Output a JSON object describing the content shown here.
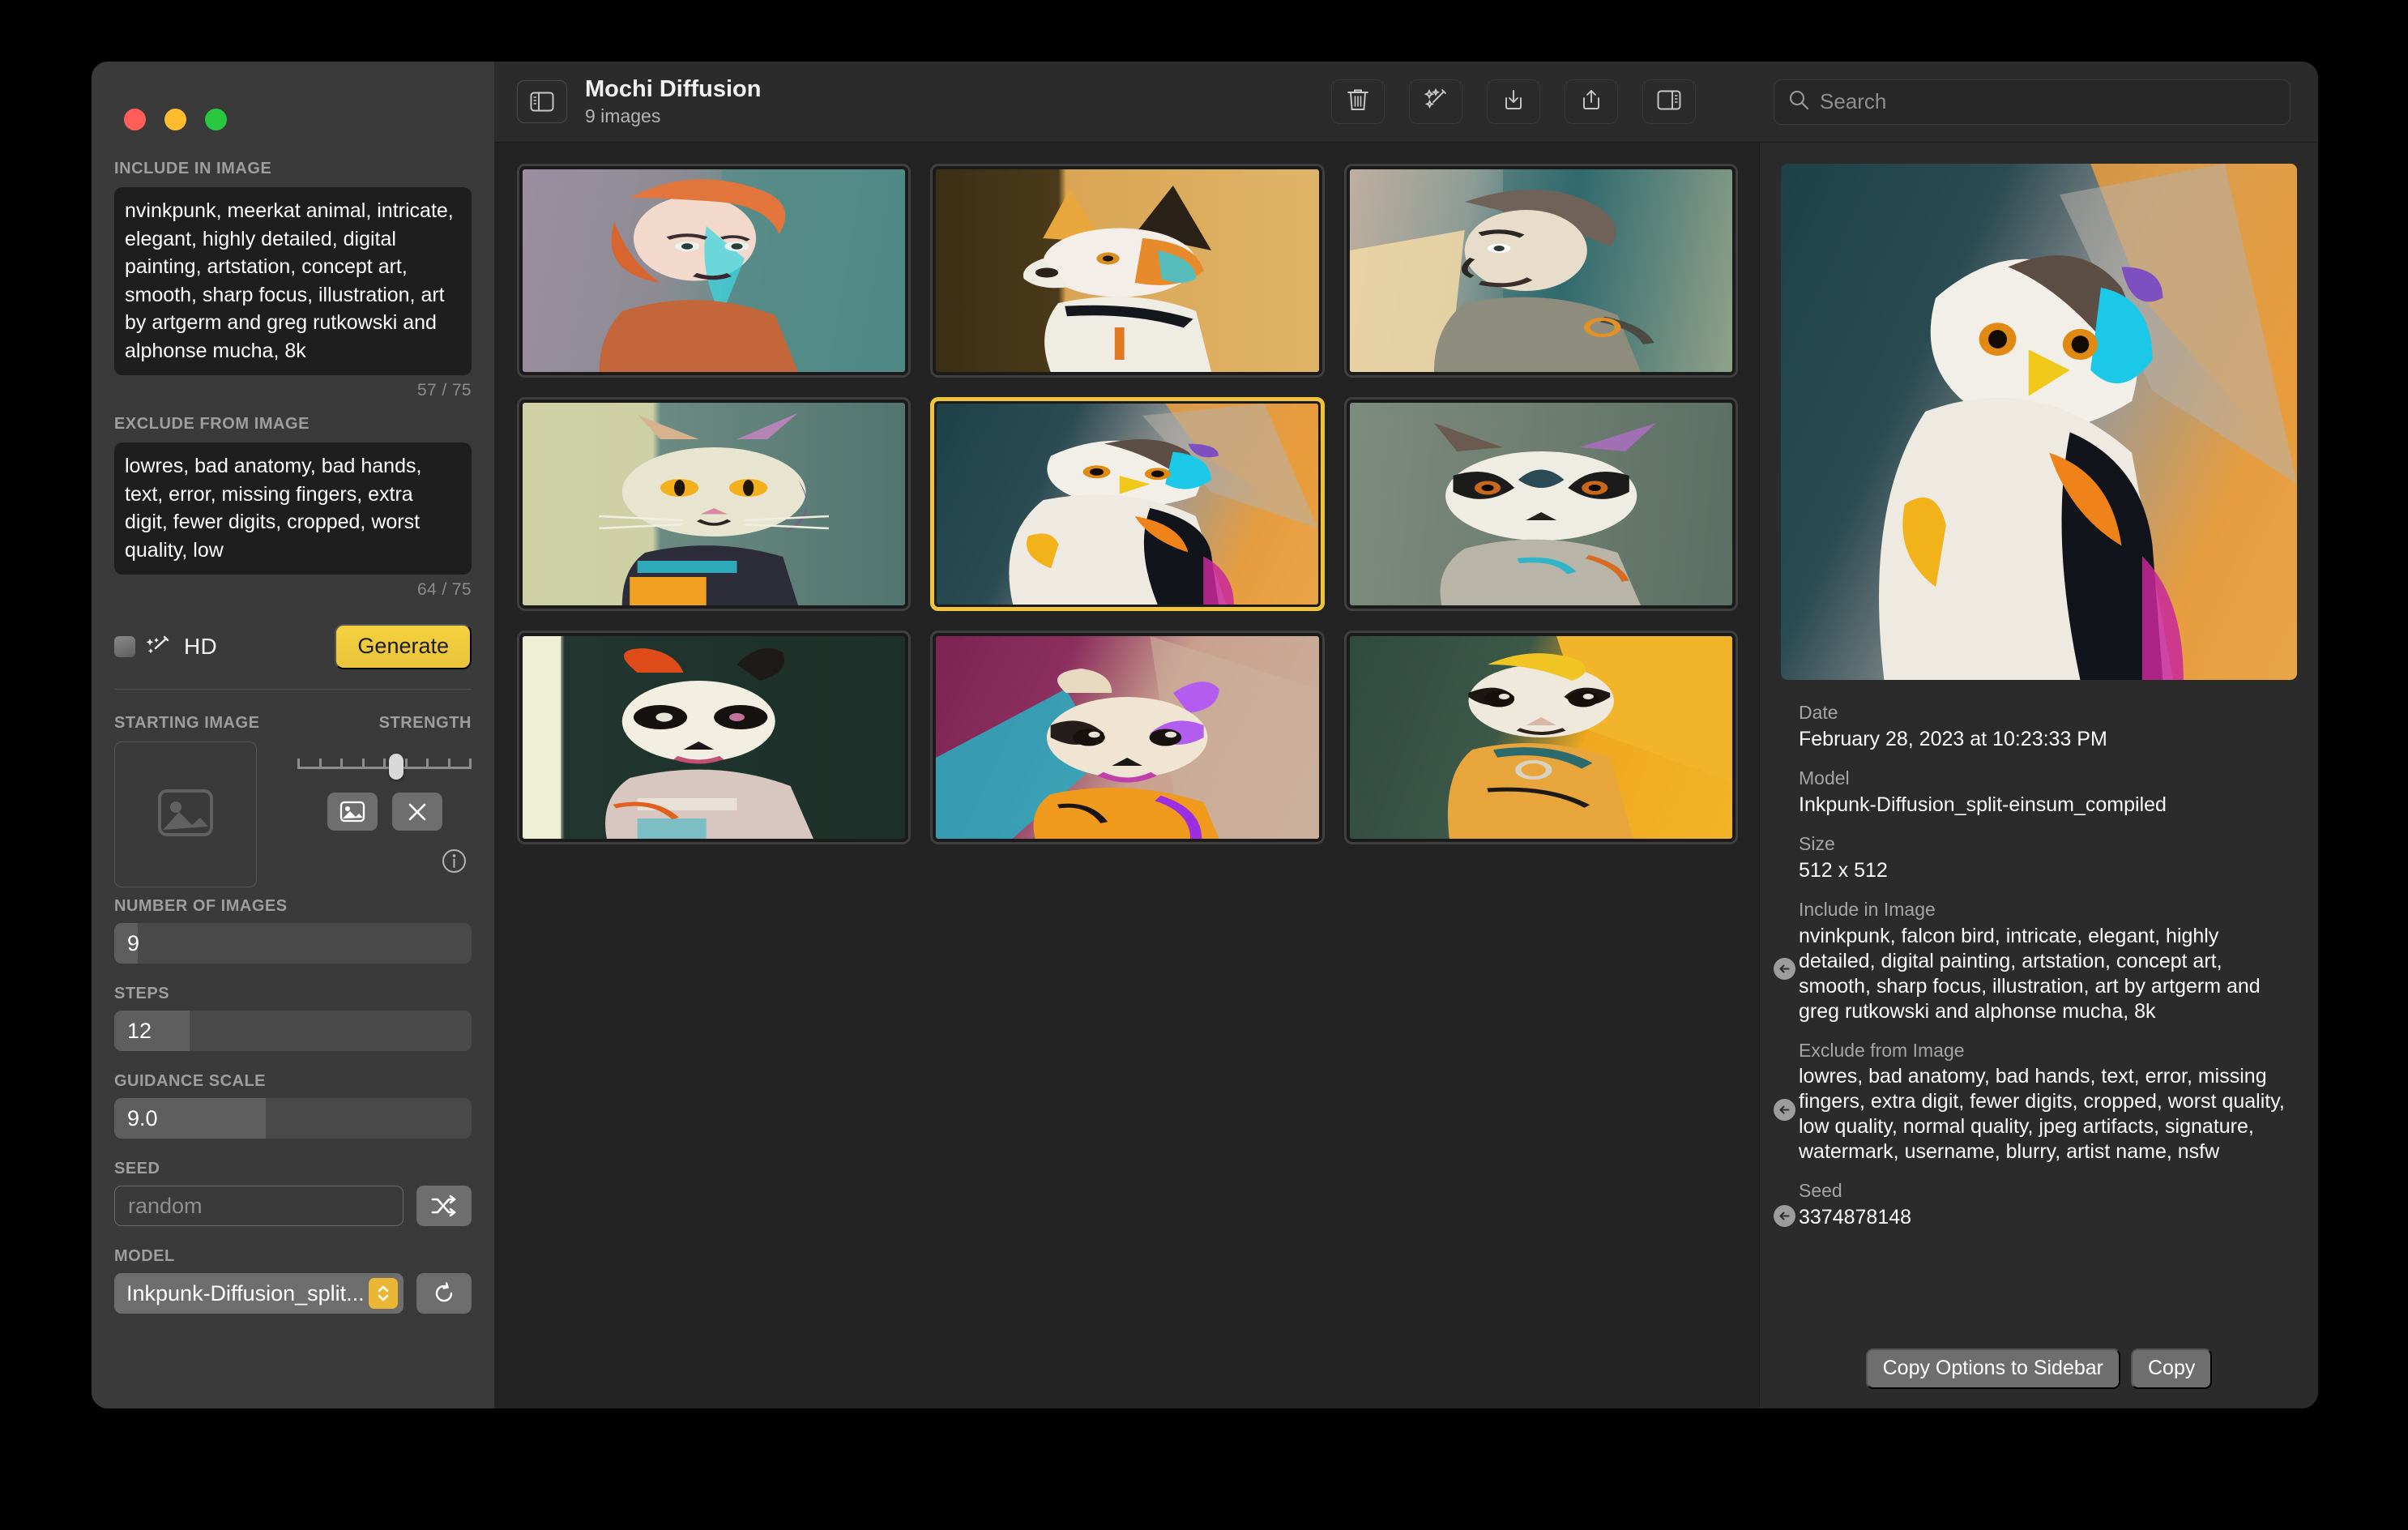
{
  "window": {
    "traffic_lights": [
      "close",
      "minimize",
      "zoom"
    ]
  },
  "sidebar": {
    "include": {
      "label": "INCLUDE IN IMAGE",
      "value": "nvinkpunk, meerkat animal, intricate, elegant, highly detailed, digital painting, artstation, concept art, smooth, sharp focus, illustration, art by artgerm and greg rutkowski and alphonse mucha, 8k",
      "counter": "57 / 75"
    },
    "exclude": {
      "label": "EXCLUDE FROM IMAGE",
      "value": "lowres, bad anatomy, bad hands, text, error, missing fingers, extra digit, fewer digits, cropped, worst quality, low",
      "counter": "64 / 75"
    },
    "hd": {
      "label": "HD",
      "checked": false
    },
    "generate_label": "Generate",
    "starting_image": {
      "label": "STARTING IMAGE",
      "empty": true
    },
    "strength": {
      "label": "STRENGTH",
      "value": 0.525
    },
    "number_of_images": {
      "label": "NUMBER OF IMAGES",
      "value": "9",
      "fill": 0.065
    },
    "steps": {
      "label": "STEPS",
      "value": "12",
      "fill": 0.21
    },
    "guidance_scale": {
      "label": "GUIDANCE SCALE",
      "value": "9.0",
      "fill": 0.425
    },
    "seed": {
      "label": "SEED",
      "value": "",
      "placeholder": "random"
    },
    "model": {
      "label": "MODEL",
      "value": "Inkpunk-Diffusion_split..."
    }
  },
  "toolbar": {
    "title": "Mochi Diffusion",
    "subtitle": "9 images",
    "buttons": [
      "trash",
      "wand",
      "download",
      "share",
      "inspector"
    ],
    "search": {
      "placeholder": "Search",
      "value": ""
    }
  },
  "gallery": {
    "items": [
      {
        "name": "woman-portrait",
        "selected": false,
        "art": "a-woman"
      },
      {
        "name": "dog-portrait",
        "selected": false,
        "art": "a-dog"
      },
      {
        "name": "man-portrait",
        "selected": false,
        "art": "a-man"
      },
      {
        "name": "cat-portrait",
        "selected": false,
        "art": "a-cat"
      },
      {
        "name": "falcon-portrait",
        "selected": true,
        "art": "a-bird"
      },
      {
        "name": "raccoon-portrait",
        "selected": false,
        "art": "a-raccoon"
      },
      {
        "name": "panda-portrait",
        "selected": false,
        "art": "a-panda"
      },
      {
        "name": "ferret-portrait",
        "selected": false,
        "art": "a-ferret"
      },
      {
        "name": "meerkat-portrait",
        "selected": false,
        "art": "a-meerkat"
      }
    ]
  },
  "inspector": {
    "preview_art": "a-bird",
    "date": {
      "key": "Date",
      "value": "February 28, 2023 at 10:23:33 PM"
    },
    "model": {
      "key": "Model",
      "value": "Inkpunk-Diffusion_split-einsum_compiled"
    },
    "size": {
      "key": "Size",
      "value": "512 x 512"
    },
    "include": {
      "key": "Include in Image",
      "value": "nvinkpunk, falcon bird, intricate, elegant, highly detailed, digital painting, artstation, concept art, smooth, sharp focus, illustration, art by artgerm and greg rutkowski and alphonse mucha, 8k"
    },
    "exclude": {
      "key": "Exclude from Image",
      "value": "lowres, bad anatomy, bad hands, text, error, missing fingers, extra digit, fewer digits, cropped, worst quality, low quality, normal quality, jpeg artifacts, signature, watermark, username, blurry, artist name, nsfw"
    },
    "seed": {
      "key": "Seed",
      "value": "3374878148"
    },
    "copy_options_label": "Copy Options to Sidebar",
    "copy_label": "Copy"
  },
  "colors": {
    "accent_yellow": "#f0c33c",
    "generate_yellow": "#f0cb3d",
    "window_bg": "#3a3a3a",
    "gallery_bg": "#232323",
    "panel_bg": "#2b2b2b"
  }
}
